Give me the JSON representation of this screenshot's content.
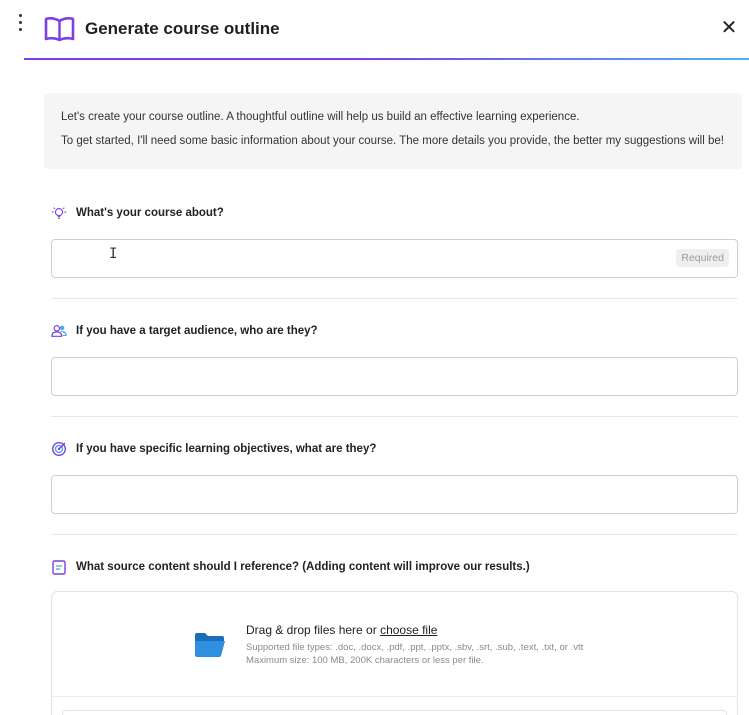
{
  "header": {
    "title": "Generate course outline",
    "close_symbol": "✕",
    "accent_gradient": [
      "#7b3fe4",
      "#4fb3e8"
    ]
  },
  "intro": {
    "line1": "Let's create your course outline. A thoughtful outline will help us build an effective learning experience.",
    "line2": "To get started, I'll need some basic information about your course. The more details you provide, the better my suggestions will be!"
  },
  "questions": {
    "course_about": {
      "label": "What's your course about?",
      "icon": "lightbulb-icon",
      "value": "",
      "badge": "Required"
    },
    "audience": {
      "label": "If you have a target audience, who are they?",
      "icon": "people-icon",
      "value": ""
    },
    "objectives": {
      "label": "If you have specific learning objectives, what are they?",
      "icon": "target-icon",
      "value": ""
    },
    "source": {
      "label": "What source content should I reference? (Adding content will improve our results.)",
      "icon": "document-icon"
    }
  },
  "dropzone": {
    "main_text": "Drag & drop files here or ",
    "choose_link": "choose file",
    "supported": "Supported file types: .doc, .docx, .pdf, .ppt, .pptx, .sbv, .srt, .sub, .text, .txt, or .vtt",
    "max_size": "Maximum size: 100 MB, 200K characters or less per file.",
    "icon": "folder-icon"
  },
  "colors": {
    "accent": "#7b3fe4",
    "folder": "#1f7fd0"
  }
}
